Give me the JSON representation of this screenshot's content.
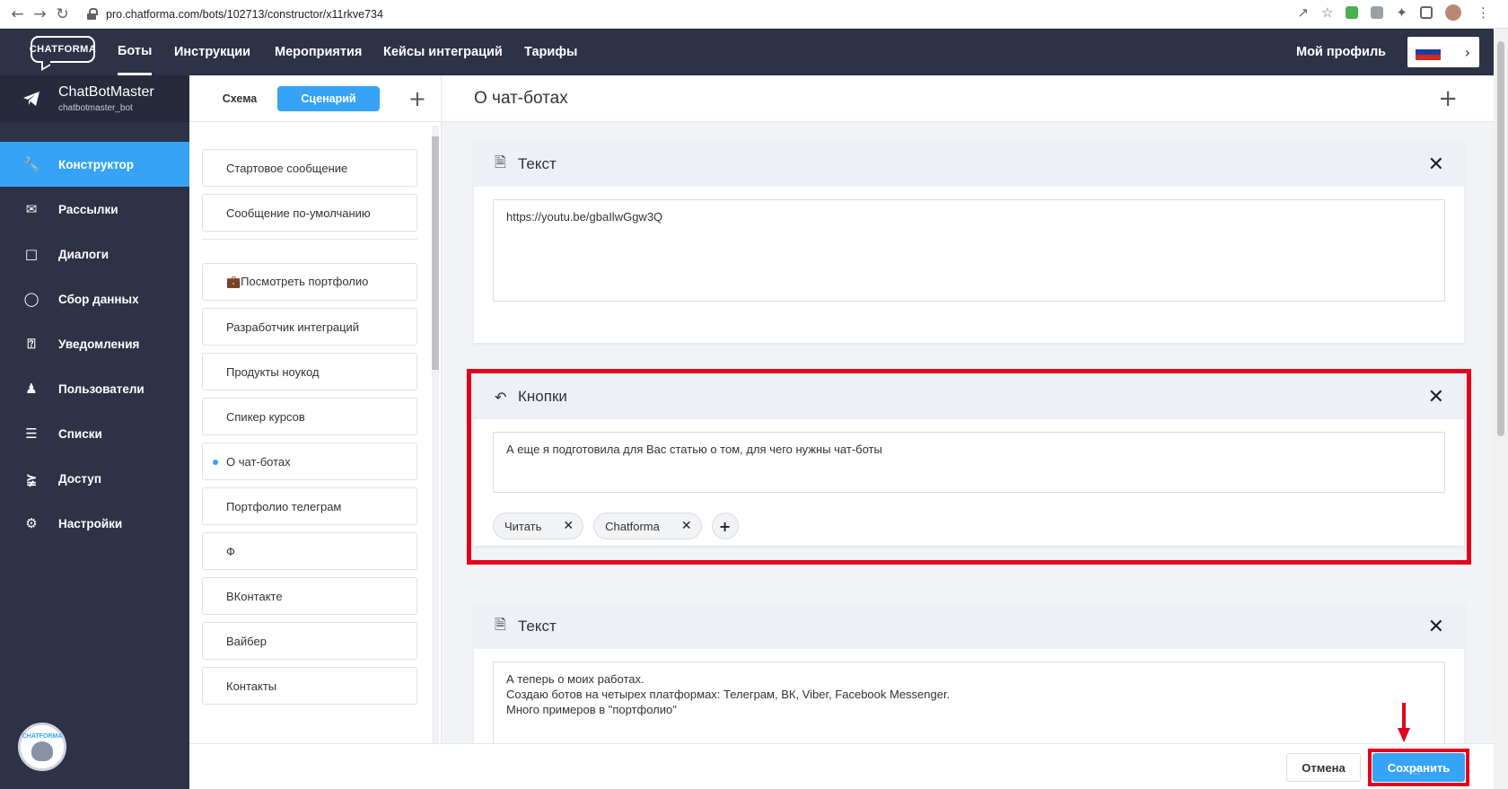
{
  "browser": {
    "url": "pro.chatforma.com/bots/102713/constructor/x11rkve734"
  },
  "topnav": {
    "logo": "CHATFORMA",
    "items": [
      "Боты",
      "Инструкции",
      "Мероприятия",
      "Кейсы интеграций",
      "Тарифы"
    ],
    "profile": "Мой профиль",
    "lang_colors": [
      "#ffffff",
      "#1c3f9c",
      "#d52b1e"
    ]
  },
  "sidebar": {
    "bot_name": "ChatBotMaster",
    "bot_username": "chatbotmaster_bot",
    "items": [
      {
        "label": "Конструктор",
        "icon": "wrench-icon"
      },
      {
        "label": "Рассылки",
        "icon": "envelope-icon"
      },
      {
        "label": "Диалоги",
        "icon": "chat-icon"
      },
      {
        "label": "Сбор данных",
        "icon": "circle-icon"
      },
      {
        "label": "Уведомления",
        "icon": "bell-icon"
      },
      {
        "label": "Пользователи",
        "icon": "users-icon"
      },
      {
        "label": "Списки",
        "icon": "list-icon"
      },
      {
        "label": "Доступ",
        "icon": "share-icon"
      },
      {
        "label": "Настройки",
        "icon": "gear-icon"
      }
    ],
    "avatar_label": "CHATFORMA"
  },
  "middle": {
    "tab_schema": "Схема",
    "tab_scenario": "Сценарий",
    "top_items": [
      "Стартовое сообщение",
      "Сообщение по-умолчанию"
    ],
    "items": [
      "💼Посмотреть портфолио",
      "Разработчик интеграций",
      "Продукты ноукод",
      "Спикер курсов",
      "О чат-ботах",
      "Портфолио телеграм",
      "Ф",
      "ВКонтакте",
      "Вайбер",
      "Контакты"
    ]
  },
  "main": {
    "title": "О чат-ботах",
    "cards": {
      "text1": {
        "title": "Текст",
        "content": "https://youtu.be/gbaIlwGgw3Q"
      },
      "buttons": {
        "title": "Кнопки",
        "content": "А еще я подготовила для Вас статью о том, для чего нужны чат-боты",
        "chips": [
          "Читать",
          "Chatforma"
        ]
      },
      "text2": {
        "title": "Текст",
        "line1": "А теперь о моих работах.",
        "line2": "Создаю ботов на четырех платформах: Телеграм, ВК, Viber, Facebook Messenger.",
        "line3": "Много примеров в \"портфолио\""
      }
    }
  },
  "footer": {
    "cancel": "Отмена",
    "save": "Сохранить"
  },
  "colors": {
    "accent": "#36a3f7",
    "sidebar": "#2e3246",
    "highlight": "#e3001b"
  }
}
